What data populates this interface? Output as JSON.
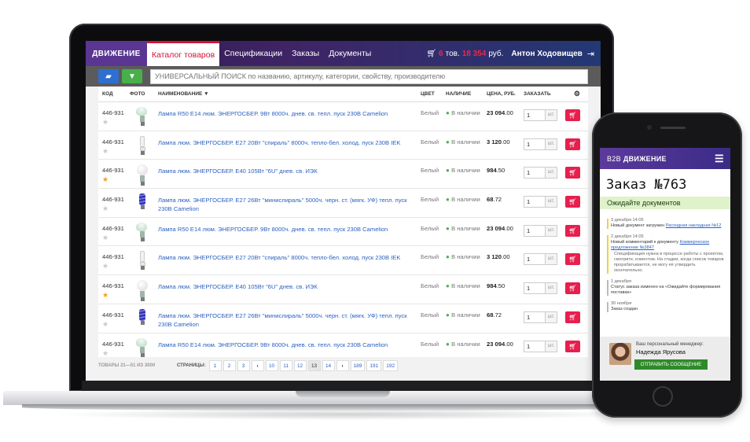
{
  "laptop": {
    "logo": "ДВИЖЕНИЕ",
    "nav": [
      {
        "label": "Каталог товаров",
        "active": true
      },
      {
        "label": "Спецификации"
      },
      {
        "label": "Заказы"
      },
      {
        "label": "Документы"
      }
    ],
    "cart": {
      "count": "6",
      "count_suffix": "тов.",
      "sum": "18 354",
      "currency": "руб."
    },
    "user": "Антон Ходовищев",
    "search_placeholder": "УНИВЕРСАЛЬНЫЙ ПОИСК по названию, артикулу, категории, свойству, производителю",
    "columns": {
      "code": "КОД",
      "photo": "ФОТО",
      "name": "НАИМЕНОВАНИЕ",
      "color": "ЦВЕТ",
      "avail": "НАЛИЧИЕ",
      "price": "ЦЕНА, РУБ.",
      "order": "ЗАКАЗАТЬ"
    },
    "rows": [
      {
        "code": "446-931",
        "fav": false,
        "bulb": "reflector",
        "name": "Лампа R50 E14 люм. ЭНЕРГОСБЕР. 9Вт 8000ч. днев. св. тепл. пуск 230В Camelion",
        "color": "Белый",
        "avail": "В наличии",
        "price_int": "23 094",
        "price_dec": ".00",
        "qty": "1",
        "unit": "шт."
      },
      {
        "code": "446-931",
        "fav": false,
        "bulb": "tube",
        "name": "Лампа люм. ЭНЕРГОСБЕР. E27 20Вт \"спираль\" 8000ч. тепло-бел. холод. пуск 230В IEK",
        "color": "Белый",
        "avail": "В наличии",
        "price_int": "3 120",
        "price_dec": ".00",
        "qty": "1",
        "unit": "шт."
      },
      {
        "code": "446-931",
        "fav": true,
        "bulb": "globe",
        "name": "Лампа люм. ЭНЕРГОСБЕР. E40 105Вт \"6U\" днев. св. ИЭК",
        "color": "Белый",
        "avail": "В наличии",
        "price_int": "984",
        "price_dec": ".50",
        "qty": "1",
        "unit": "шт."
      },
      {
        "code": "446-931",
        "fav": false,
        "bulb": "spiral",
        "name": "Лампа люм. ЭНЕРГОСБЕР. E27 26Вт \"минислираль\" 5000ч. черн. ст. (мягк. УФ) тепл. пуск 230В Camelion",
        "color": "Белый",
        "avail": "В наличии",
        "price_int": "68",
        "price_dec": ".72",
        "qty": "1",
        "unit": "шт."
      },
      {
        "code": "446-931",
        "fav": false,
        "bulb": "reflector",
        "name": "Лампа R50 E14 люм. ЭНЕРГОСБЕР. 9Вт 8000ч. днев. св. тепл. пуск 230В Camelion",
        "color": "Белый",
        "avail": "В наличии",
        "price_int": "23 094",
        "price_dec": ".00",
        "qty": "1",
        "unit": "шт."
      },
      {
        "code": "446-931",
        "fav": false,
        "bulb": "tube",
        "name": "Лампа люм. ЭНЕРГОСБЕР. E27 20Вт \"спираль\" 8000ч. тепло-бел. холод. пуск 230В IEK",
        "color": "Белый",
        "avail": "В наличии",
        "price_int": "3 120",
        "price_dec": ".00",
        "qty": "1",
        "unit": "шт."
      },
      {
        "code": "446-931",
        "fav": true,
        "bulb": "globe",
        "name": "Лампа люм. ЭНЕРГОСБЕР. E40 105Вт \"6U\" днев. св. ИЭК",
        "color": "Белый",
        "avail": "В наличии",
        "price_int": "984",
        "price_dec": ".50",
        "qty": "1",
        "unit": "шт."
      },
      {
        "code": "446-931",
        "fav": false,
        "bulb": "spiral",
        "name": "Лампа люм. ЭНЕРГОСБЕР. E27 26Вт \"минислираль\" 5000ч. черн. ст. (мягк. УФ) тепл. пуск 230В Camelion",
        "color": "Белый",
        "avail": "В наличии",
        "price_int": "68",
        "price_dec": ".72",
        "qty": "1",
        "unit": "шт."
      },
      {
        "code": "446-931",
        "fav": false,
        "bulb": "reflector",
        "name": "Лампа R50 E14 люм. ЭНЕРГОСБЕР. 9Вт 8000ч. днев. св. тепл. пуск 230В Camelion",
        "color": "Белый",
        "avail": "В наличии",
        "price_int": "23 094",
        "price_dec": ".00",
        "qty": "1",
        "unit": "шт."
      }
    ],
    "pager": {
      "total": "ТОВАРЫ 21—51 ИЗ 3000",
      "label": "СТРАНИЦЫ:",
      "pages": [
        "1",
        "2",
        "3",
        "‹",
        "10",
        "11",
        "12",
        "13",
        "14",
        "›",
        "189",
        "191",
        "192"
      ],
      "current": "13"
    }
  },
  "phone": {
    "b2b": "B2B",
    "logo": "ДВИЖЕНИЕ",
    "order_title": "Заказ №763",
    "order_status": "Ожидайте документов",
    "feed": [
      {
        "bar": "yellow",
        "date": "3 декабря 14:05",
        "text": "Новый документ загружен ",
        "link": "Расходная накладная №12",
        "note": ""
      },
      {
        "bar": "yellow",
        "date": "2 декабря 14:05",
        "text": "Новый комментарий к документу ",
        "link": "Коммерческое предложение №3847",
        "note": "Спецификация нужна в процессе работы с проектом, смотрите, клиентом. На стадии, когда список товаров прорабатывается, не могу её утвердить окончательно."
      },
      {
        "bar": "gray",
        "date": "1 декабря",
        "text": "Статус заказа изменен на «Ожидайте формирования поставки»",
        "link": "",
        "note": ""
      },
      {
        "bar": "gray",
        "date": "30 ноября",
        "text": "Заказ создан",
        "link": "",
        "note": ""
      }
    ],
    "manager": {
      "caption": "Ваш персональный менеджер:",
      "name": "Надежда Ярусова",
      "button": "ОТПРАВИТЬ СООБЩЕНИЕ"
    }
  },
  "colors": {
    "accent_red": "#e61f4d",
    "link_blue": "#2c62c0",
    "brand_purple": "#5a3692",
    "in_stock_green": "#4db14f",
    "send_green": "#2f8a2a"
  }
}
